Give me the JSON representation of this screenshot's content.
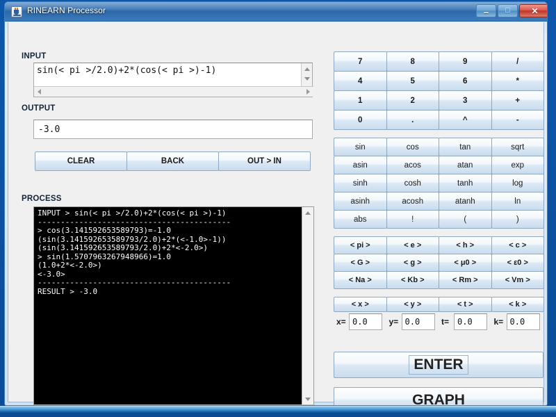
{
  "window": {
    "title": "RINEARN Processor",
    "icon": "java-coffee-cup-icon",
    "controls": {
      "minimize": "–",
      "maximize": "□",
      "close": "✕"
    }
  },
  "left": {
    "input_label": "INPUT",
    "input_value": "sin(< pi >/2.0)+2*(cos(< pi >)-1)",
    "output_label": "OUTPUT",
    "output_value": "-3.0",
    "actions": [
      "CLEAR",
      "BACK",
      "OUT > IN"
    ],
    "process_label": "PROCESS",
    "process_text": "INPUT > sin(< pi >/2.0)+2*(cos(< pi >)-1)\n------------------------------------------\n> cos(3.141592653589793)=-1.0\n(sin(3.141592653589793/2.0)+2*(<-1.0>-1))\n(sin(3.141592653589793/2.0)+2*<-2.0>)\n> sin(1.5707963267948966)=1.0\n(1.0+2*<-2.0>)\n<-3.0>\n------------------------------------------\nRESULT > -3.0"
  },
  "keypad": {
    "numbers": [
      "7",
      "8",
      "9",
      "/",
      "4",
      "5",
      "6",
      "*",
      "1",
      "2",
      "3",
      "+",
      "0",
      ".",
      "^",
      "-"
    ],
    "functions": [
      "sin",
      "cos",
      "tan",
      "sqrt",
      "asin",
      "acos",
      "atan",
      "exp",
      "sinh",
      "cosh",
      "tanh",
      "log",
      "asinh",
      "acosh",
      "atanh",
      "ln",
      "abs",
      "!",
      "(",
      ")"
    ],
    "constants": [
      "< pi >",
      "< e >",
      "< h >",
      "< c >",
      "< G >",
      "< g >",
      "< μ0 >",
      "< ε0 >",
      "< Na >",
      "< Kb >",
      "< Rm >",
      "< Vm >"
    ],
    "variables": [
      "< x >",
      "< y >",
      "< t >",
      "< k >"
    ],
    "variable_fields": [
      {
        "label": "x=",
        "value": "0.0"
      },
      {
        "label": "y=",
        "value": "0.0"
      },
      {
        "label": "t=",
        "value": "0.0"
      },
      {
        "label": "k=",
        "value": "0.0"
      }
    ],
    "enter_label": "ENTER",
    "graph_label": "GRAPH"
  },
  "colors": {
    "titlebar": "#2f6fb2",
    "close_button": "#bf3526",
    "button_face": "#dce9f5",
    "console_bg": "#000000",
    "console_fg": "#ffffff",
    "panel_bg": "#f0f0f0"
  }
}
